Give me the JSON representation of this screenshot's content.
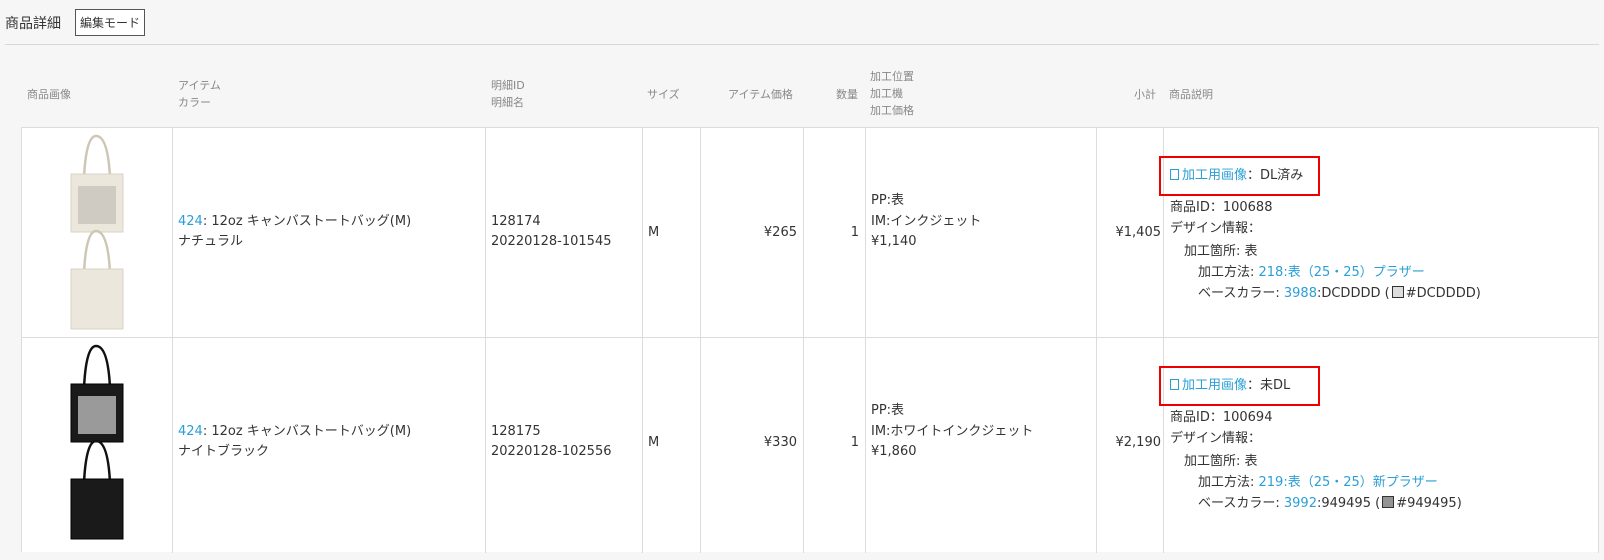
{
  "header": {
    "title": "商品詳細",
    "mode_button": "編集モード"
  },
  "columns": {
    "image": "商品画像",
    "item": "アイテム",
    "color": "カラー",
    "detail_id": "明細ID",
    "detail_name": "明細名",
    "size": "サイズ",
    "price": "アイテム価格",
    "qty": "数量",
    "proc_pos": "加工位置",
    "proc_machine": "加工機",
    "proc_price": "加工価格",
    "subtotal": "小計",
    "desc": "商品説明"
  },
  "rows": [
    {
      "item_id": "424",
      "item_name": ": 12oz キャンバストートバッグ(M)",
      "color": "ナチュラル",
      "detail_id": "128174",
      "detail_name": "20220128-101545",
      "size": "M",
      "price": "¥265",
      "qty": "1",
      "proc_pos": "PP:表",
      "proc_machine": "IM:インクジェット",
      "proc_price": "¥1,140",
      "subtotal": "¥1,405",
      "desc": {
        "image_link": "加工用画像",
        "image_status": "：DL済み",
        "product_id": "商品ID：100688",
        "design_info": "デザイン情報：",
        "proc_place": "加工箇所: 表",
        "method_label": "加工方法: ",
        "method_link": "218:表（25・25）プラザー",
        "base_label": "ベースカラー: ",
        "base_link": "3988",
        "base_code": ":DCDDDD (",
        "base_hex": "#DCDDDD)",
        "swatch": "#DCDDDD"
      }
    },
    {
      "item_id": "424",
      "item_name": ": 12oz キャンバストートバッグ(M)",
      "color": "ナイトブラック",
      "detail_id": "128175",
      "detail_name": "20220128-102556",
      "size": "M",
      "price": "¥330",
      "qty": "1",
      "proc_pos": "PP:表",
      "proc_machine": "IM:ホワイトインクジェット",
      "proc_price": "¥1,860",
      "subtotal": "¥2,190",
      "desc": {
        "image_link": "加工用画像",
        "image_status": "：未DL",
        "product_id": "商品ID：100694",
        "design_info": "デザイン情報：",
        "proc_place": "加工箇所: 表",
        "method_label": "加工方法: ",
        "method_link": "219:表（25・25）新プラザー",
        "base_label": "ベースカラー: ",
        "base_link": "3992",
        "base_code": ":949495 (",
        "base_hex": "#949495)",
        "swatch": "#949495"
      }
    }
  ]
}
